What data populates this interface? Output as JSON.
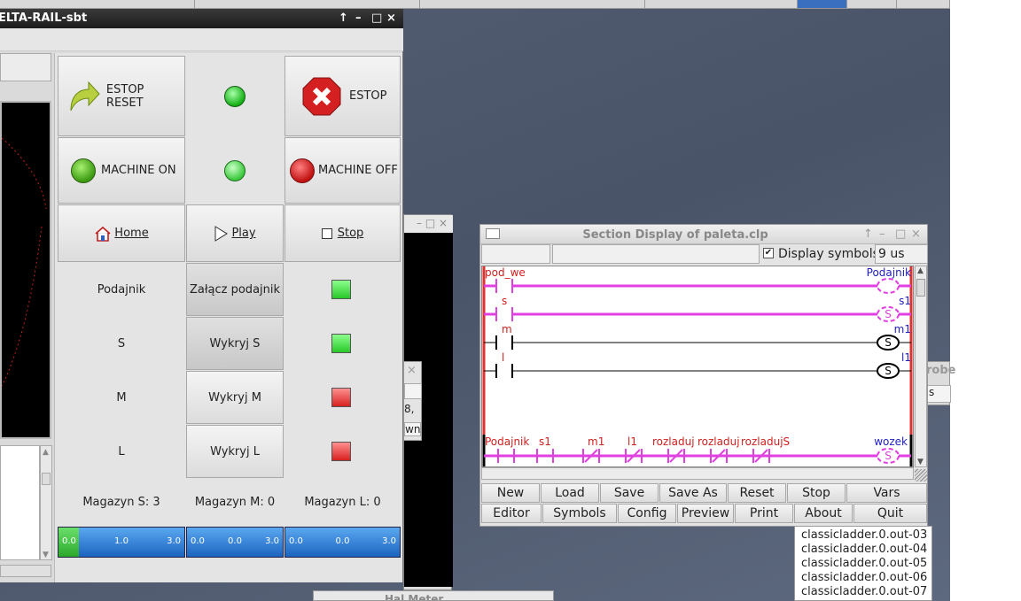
{
  "main_window": {
    "title": "ELTA-RAIL-sbt",
    "title_controls": [
      "↑",
      "–",
      "□",
      "×"
    ]
  },
  "estop": {
    "reset_label": "ESTOP RESET",
    "label": "ESTOP"
  },
  "machine": {
    "on_label": "MACHINE ON",
    "off_label": "MACHINE OFF"
  },
  "nav": {
    "home": "Home",
    "play": "Play",
    "stop": "Stop"
  },
  "rows": [
    {
      "label": "Podajnik",
      "button": "Załącz podajnik",
      "status": "green"
    },
    {
      "label": "S",
      "button": "Wykryj S",
      "status": "green"
    },
    {
      "label": "M",
      "button": "Wykryj M",
      "status": "red"
    },
    {
      "label": "L",
      "button": "Wykryj L",
      "status": "red"
    }
  ],
  "magazyn": [
    "Magazyn S: 3",
    "Magazyn M: 0",
    "Magazyn L: 0"
  ],
  "bars": [
    {
      "ticks": [
        "0.0",
        "1.0",
        "3.0"
      ],
      "fill": 0.16
    },
    {
      "ticks": [
        "0.0",
        "0.0",
        "3.0"
      ],
      "fill": 0
    },
    {
      "ticks": [
        "0.0",
        "0.0",
        "3.0"
      ],
      "fill": 0
    }
  ],
  "colors": {
    "green": "#35d835",
    "red": "#e03030",
    "rung_active": "#e040e0",
    "bar": "#2a7fd8"
  },
  "ladder": {
    "title": "Section Display of paleta.clp",
    "display_symbols_label": "Display symbols",
    "display_symbols_checked": true,
    "scan_time": "9 us",
    "rungs": [
      {
        "contact": "pod_we",
        "coil": "Podajnik",
        "coil_type": "",
        "active": true
      },
      {
        "contact": "s",
        "coil": "s1",
        "coil_type": "S",
        "active": true
      },
      {
        "contact": "m",
        "coil": "m1",
        "coil_type": "S",
        "active": false
      },
      {
        "contact": "l",
        "coil": "l1",
        "coil_type": "S",
        "active": false
      }
    ],
    "bottom_rung": {
      "contacts": [
        "Podajnik",
        "s1",
        "m1",
        "l1",
        "rozladuj",
        "rozladuj",
        "rozladujS"
      ],
      "coil": "wozek",
      "coil_type": "S"
    },
    "buttons_row1": [
      "New",
      "Load",
      "Save",
      "Save As",
      "Reset",
      "Stop",
      "Vars"
    ],
    "buttons_row2": [
      "Editor",
      "Symbols",
      "Config",
      "Preview",
      "Print",
      "About",
      "Quit"
    ]
  },
  "bg_list": [
    "classicladder.0.out-03",
    "classicladder.0.out-04",
    "classicladder.0.out-05",
    "classicladder.0.out-06",
    "classicladder.0.out-07"
  ],
  "bg_fragments": {
    "probe": "robe",
    "s": "s",
    "eight": "8,",
    "wn": "wn",
    "halmeter": "Hal Meter"
  }
}
